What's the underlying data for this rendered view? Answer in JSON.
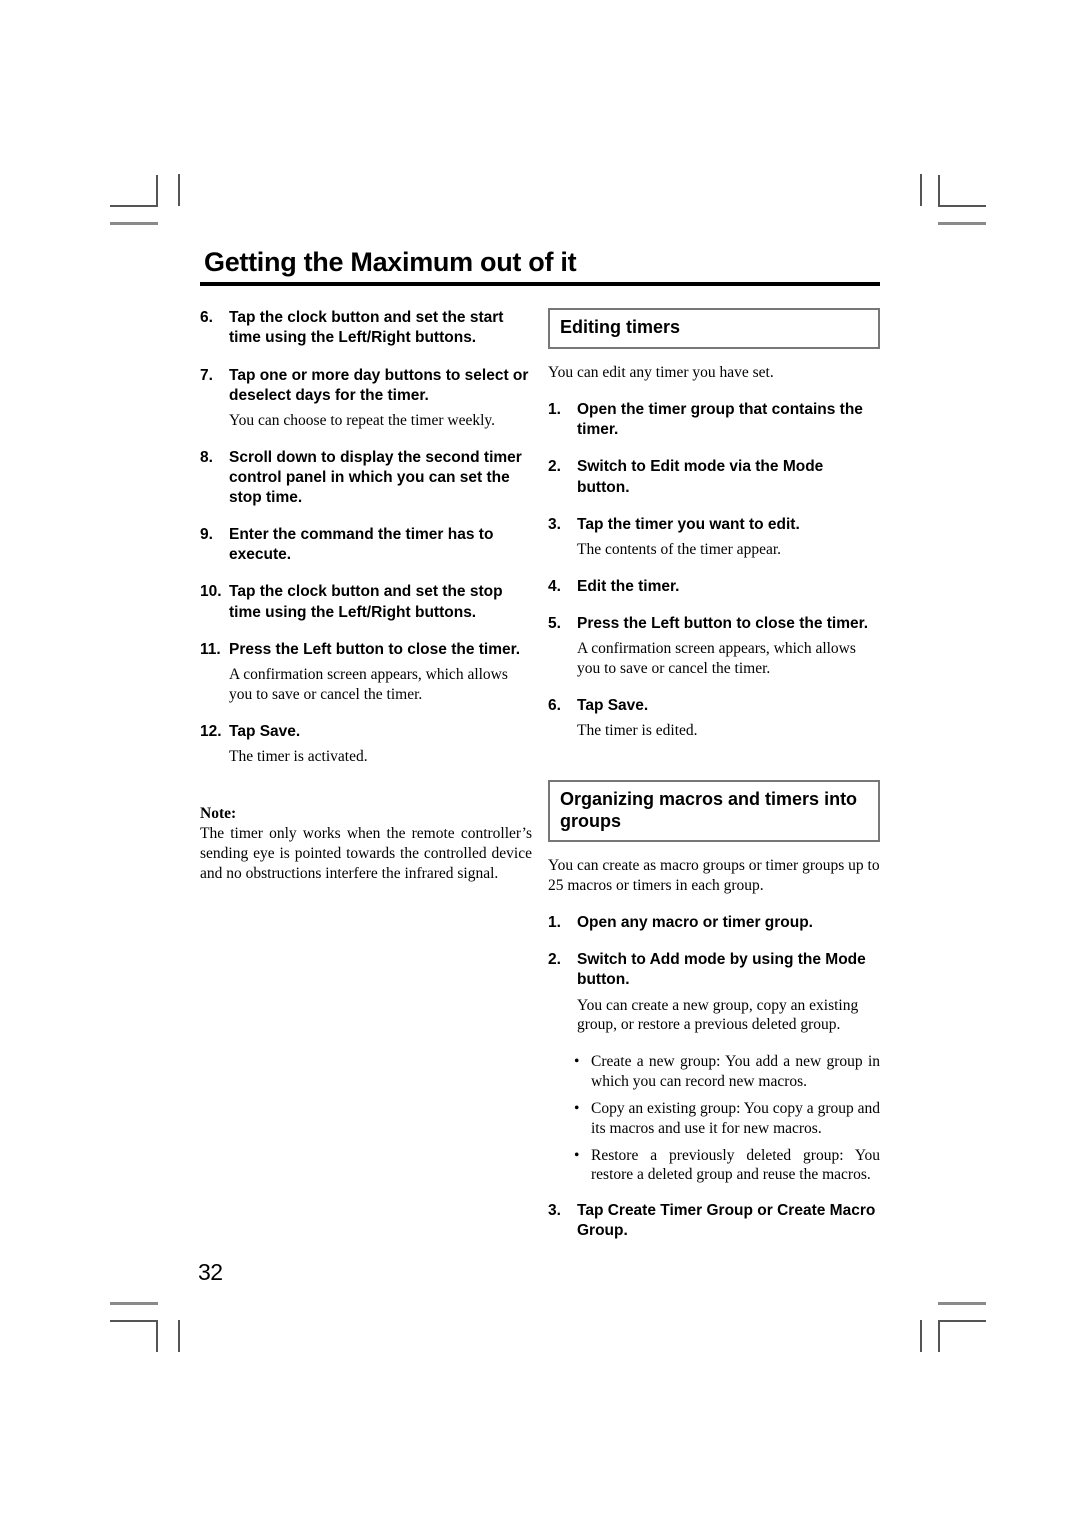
{
  "page": {
    "title": "Getting the Maximum out of it",
    "number": "32"
  },
  "left_column": {
    "steps": [
      {
        "num": "6.",
        "text": "Tap the clock button and set the start time using the Left/Right buttons."
      },
      {
        "num": "7.",
        "text": "Tap one or more day buttons to select or deselect days for the timer."
      },
      {
        "num": "8.",
        "text": "Scroll down to display the second timer control panel in which you can set the stop time."
      },
      {
        "num": "9.",
        "text": "Enter the command the timer has to execute."
      },
      {
        "num": "10.",
        "text": "Tap the clock button and set the stop time using the Left/Right buttons."
      },
      {
        "num": "11.",
        "text": "Press the Left button to close the timer."
      },
      {
        "num": "12.",
        "text": "Tap Save."
      }
    ],
    "note_after_step7": "You can choose to repeat the timer weekly.",
    "note_after_step11": "A confirmation screen appears, which allows you to save or cancel the timer.",
    "note_after_step12": "The timer is activated.",
    "note": {
      "label": "Note:",
      "text": "The timer only works when the remote controller’s sending eye is pointed towards the controlled device and no obstructions interfere the infrared signal."
    }
  },
  "right_column": {
    "section_editing": {
      "heading": "Editing timers",
      "intro": "You can edit any timer you have set.",
      "steps": [
        {
          "num": "1.",
          "text": "Open the timer group that contains the timer."
        },
        {
          "num": "2.",
          "text": "Switch to Edit mode via the Mode button."
        },
        {
          "num": "3.",
          "text": "Tap the timer you want to edit."
        },
        {
          "num": "4.",
          "text": "Edit the timer."
        },
        {
          "num": "5.",
          "text": "Press the Left button to close the timer."
        },
        {
          "num": "6.",
          "text": "Tap Save."
        }
      ],
      "note_after_step3": "The contents of the timer appear.",
      "note_after_step5": "A confirmation screen appears, which allows you to save or cancel the timer.",
      "note_after_step6": "The timer is edited."
    },
    "section_organizing": {
      "heading": "Organizing macros and timers into groups",
      "intro": "You can create as macro groups or timer groups up to 25 macros or timers in each group.",
      "steps": [
        {
          "num": "1.",
          "text": "Open any macro or timer group."
        },
        {
          "num": "2.",
          "text": "Switch to Add mode by using the Mode button."
        },
        {
          "num": "3.",
          "text": "Tap Create Timer Group or Create Macro Group."
        }
      ],
      "note_after_step2": "You can create a new group, copy an existing group, or restore a previous deleted group.",
      "bullets": [
        {
          "marker": "•",
          "text": "Create a new group: You add a new group in which you can record new macros."
        },
        {
          "marker": "•",
          "text": "Copy an existing group: You copy a group and its macros and use it for new macros."
        },
        {
          "marker": "•",
          "text": "Restore a previously deleted group: You restore a deleted group and reuse the macros."
        }
      ]
    }
  }
}
